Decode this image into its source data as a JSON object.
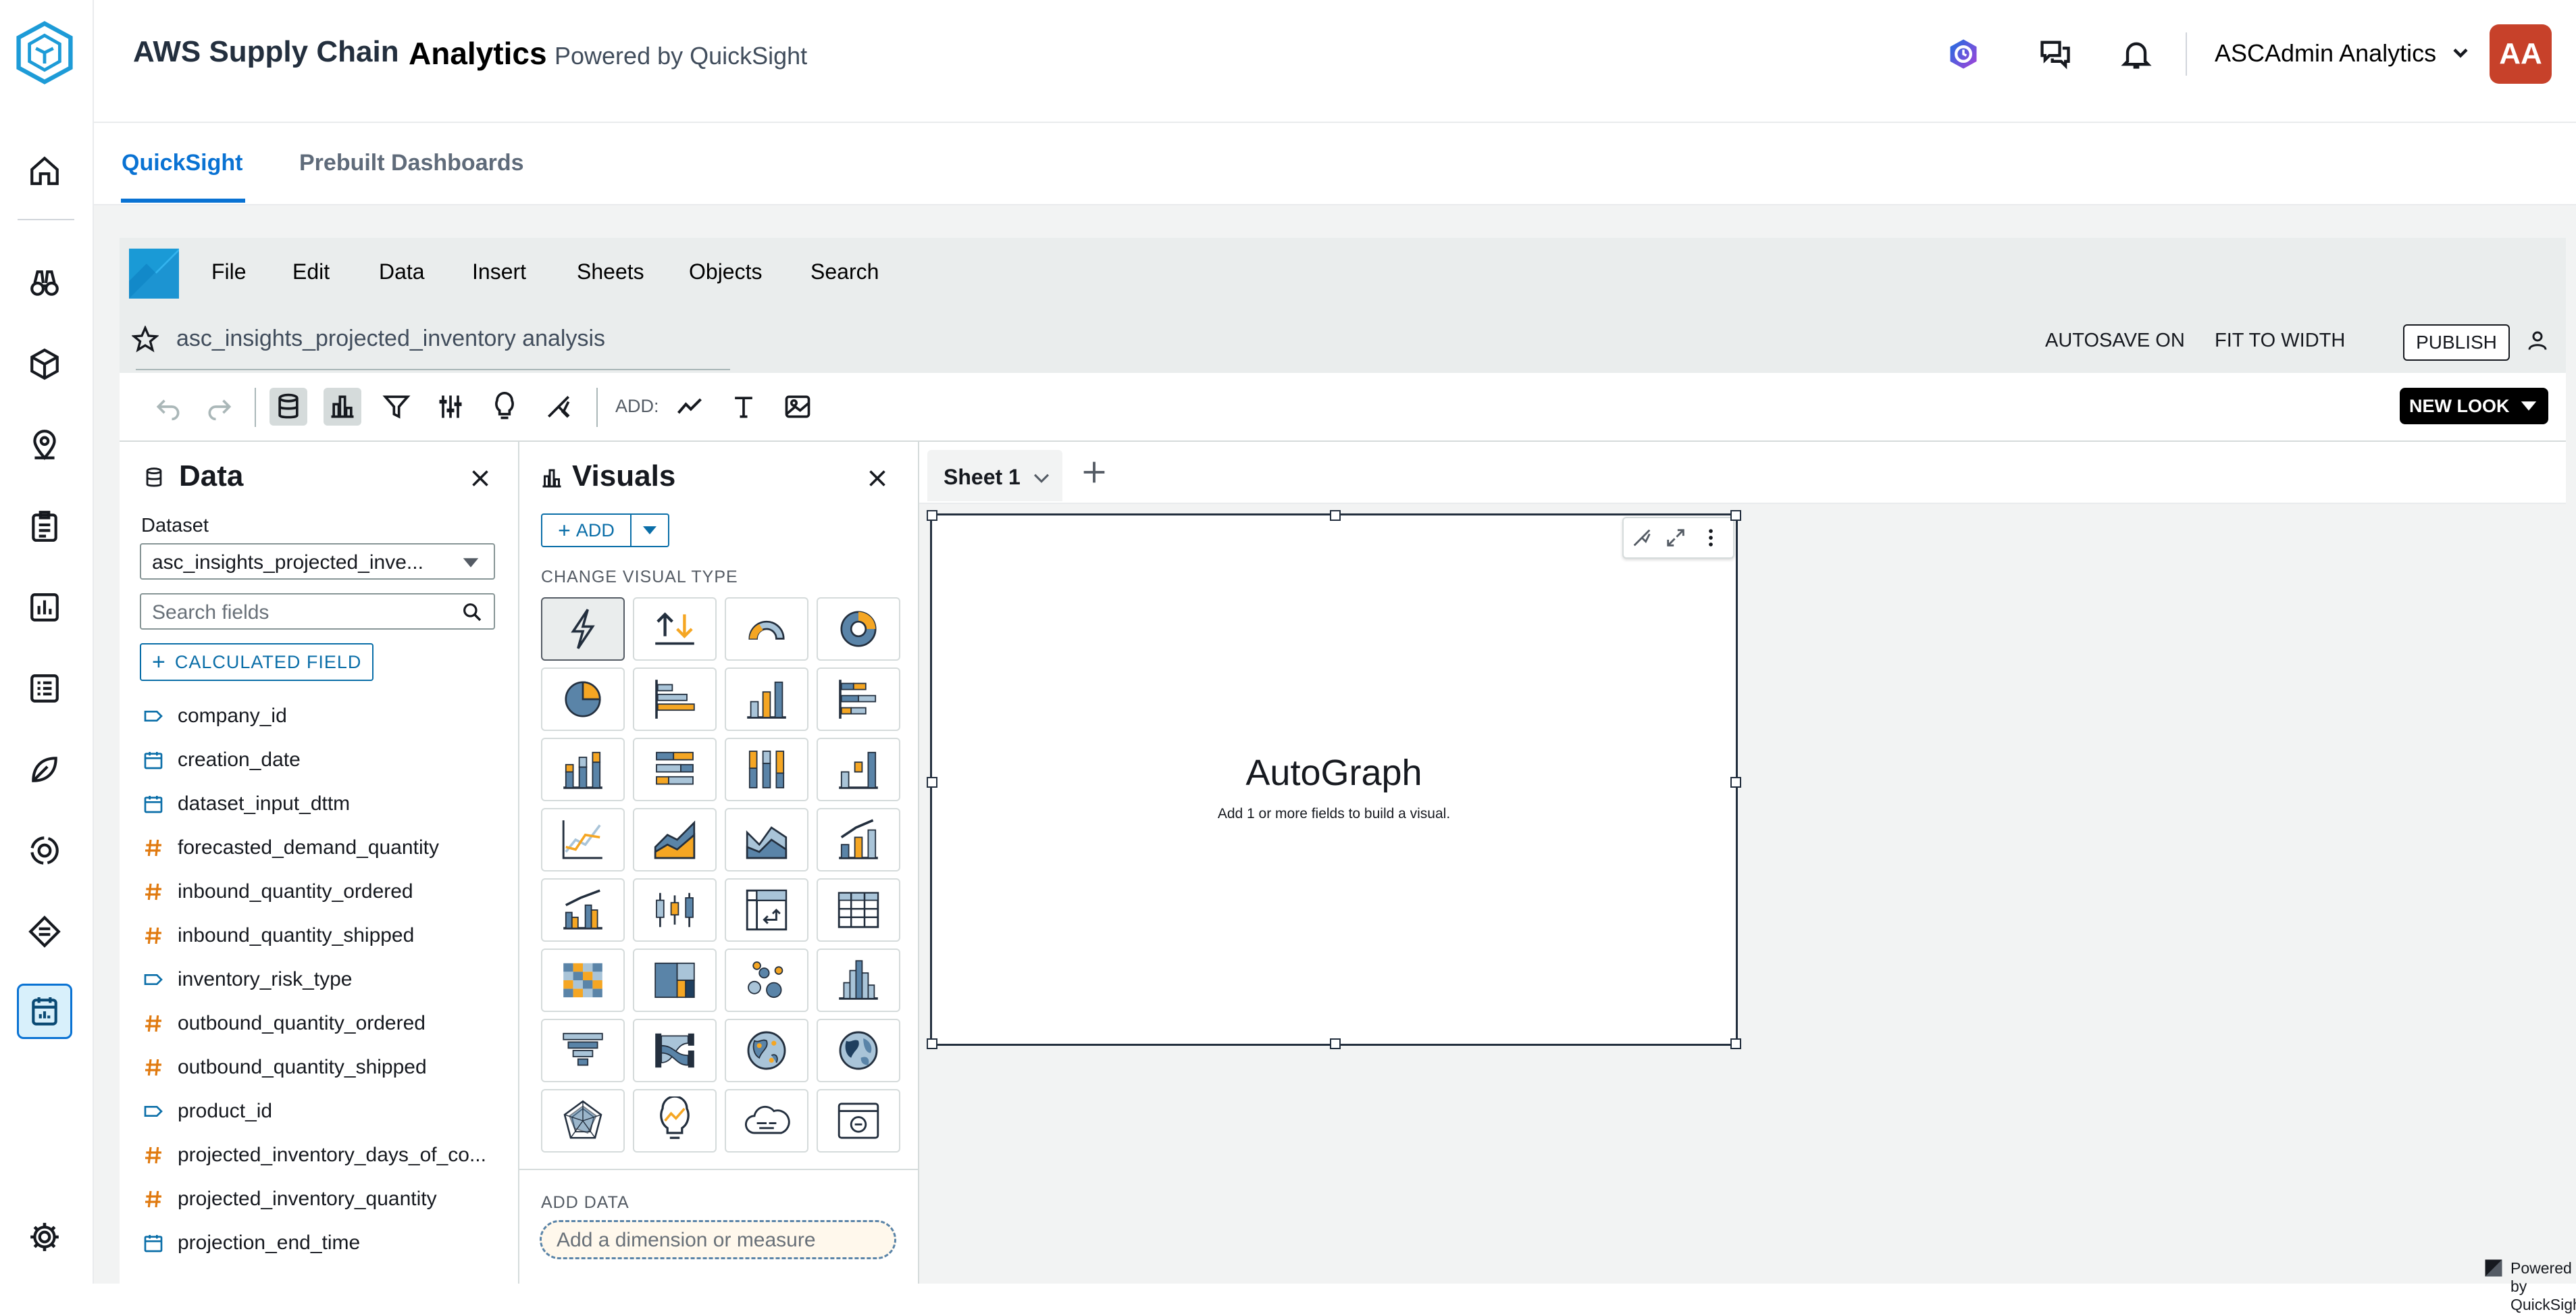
{
  "header": {
    "app_title": "AWS Supply Chain",
    "app_title_bold": "Analytics",
    "powered_by": "Powered by QuickSight",
    "user_name": "ASCAdmin Analytics",
    "avatar_initials": "AA"
  },
  "tabs": [
    {
      "label": "QuickSight",
      "active": true
    },
    {
      "label": "Prebuilt Dashboards",
      "active": false
    }
  ],
  "quicksight": {
    "menu": [
      "File",
      "Edit",
      "Data",
      "Insert",
      "Sheets",
      "Objects",
      "Search"
    ],
    "analysis_name": "asc_insights_projected_inventory analysis",
    "autosave": "AUTOSAVE ON",
    "fit": "FIT TO WIDTH",
    "publish": "PUBLISH",
    "add_label": "ADD:",
    "new_look": "NEW LOOK"
  },
  "data_panel": {
    "title": "Data",
    "dataset_label": "Dataset",
    "dataset_value": "asc_insights_projected_inve...",
    "search_placeholder": "Search fields",
    "calculated_field": "CALCULATED FIELD",
    "fields": [
      {
        "name": "company_id",
        "kind": "dimension"
      },
      {
        "name": "creation_date",
        "kind": "date"
      },
      {
        "name": "dataset_input_dttm",
        "kind": "date"
      },
      {
        "name": "forecasted_demand_quantity",
        "kind": "measure"
      },
      {
        "name": "inbound_quantity_ordered",
        "kind": "measure"
      },
      {
        "name": "inbound_quantity_shipped",
        "kind": "measure"
      },
      {
        "name": "inventory_risk_type",
        "kind": "dimension"
      },
      {
        "name": "outbound_quantity_ordered",
        "kind": "measure"
      },
      {
        "name": "outbound_quantity_shipped",
        "kind": "measure"
      },
      {
        "name": "product_id",
        "kind": "dimension"
      },
      {
        "name": "projected_inventory_days_of_co...",
        "kind": "measure"
      },
      {
        "name": "projected_inventory_quantity",
        "kind": "measure"
      },
      {
        "name": "projection_end_time",
        "kind": "date"
      }
    ]
  },
  "visuals_panel": {
    "title": "Visuals",
    "add": "ADD",
    "change_type": "CHANGE VISUAL TYPE",
    "add_data": "ADD DATA",
    "add_data_placeholder": "Add a dimension or measure"
  },
  "canvas": {
    "sheet_name": "Sheet 1",
    "visual_title": "AutoGraph",
    "visual_hint": "Add 1 or more fields to build a visual.",
    "footer": "Powered by QuickSight"
  },
  "colors": {
    "accent": "#0972d3",
    "avatar": "#c7412a",
    "chart_orange": "#f5a623",
    "chart_blue": "#5a84a8",
    "chart_light": "#a9c4d8"
  }
}
